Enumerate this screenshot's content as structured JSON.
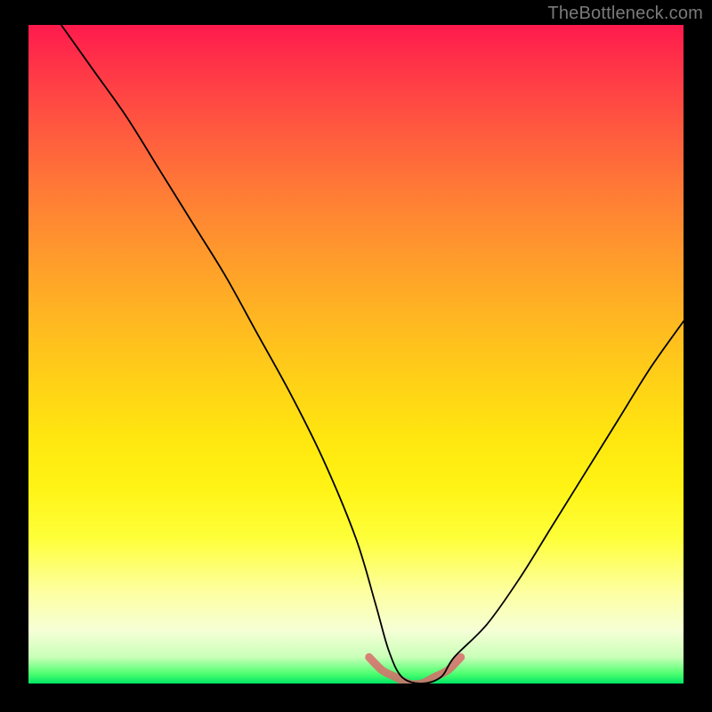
{
  "watermark": "TheBottleneck.com",
  "chart_data": {
    "type": "line",
    "title": "",
    "xlabel": "",
    "ylabel": "",
    "xlim": [
      0,
      100
    ],
    "ylim": [
      0,
      100
    ],
    "grid": false,
    "legend": false,
    "annotations": [],
    "background_gradient_stops": [
      {
        "pos": 0,
        "color": "#ff1a4d"
      },
      {
        "pos": 35,
        "color": "#ff9a2c"
      },
      {
        "pos": 63,
        "color": "#ffe70f"
      },
      {
        "pos": 92,
        "color": "#f6ffd6"
      },
      {
        "pos": 100,
        "color": "#00e664"
      }
    ],
    "series": [
      {
        "name": "bottleneck-curve",
        "x": [
          5,
          10,
          15,
          20,
          25,
          30,
          35,
          40,
          45,
          50,
          53,
          55,
          57,
          60,
          63,
          65,
          70,
          75,
          80,
          85,
          90,
          95,
          100
        ],
        "values": [
          100,
          93,
          86,
          78,
          70,
          62,
          53,
          44,
          34,
          22,
          12,
          5,
          1,
          0,
          1,
          4,
          9,
          16,
          24,
          32,
          40,
          48,
          55
        ]
      },
      {
        "name": "safe-zone-accent",
        "x": [
          52,
          54,
          56,
          58,
          60,
          62,
          64,
          66
        ],
        "values": [
          4,
          2,
          1,
          0,
          0,
          1,
          2,
          4
        ]
      }
    ]
  }
}
